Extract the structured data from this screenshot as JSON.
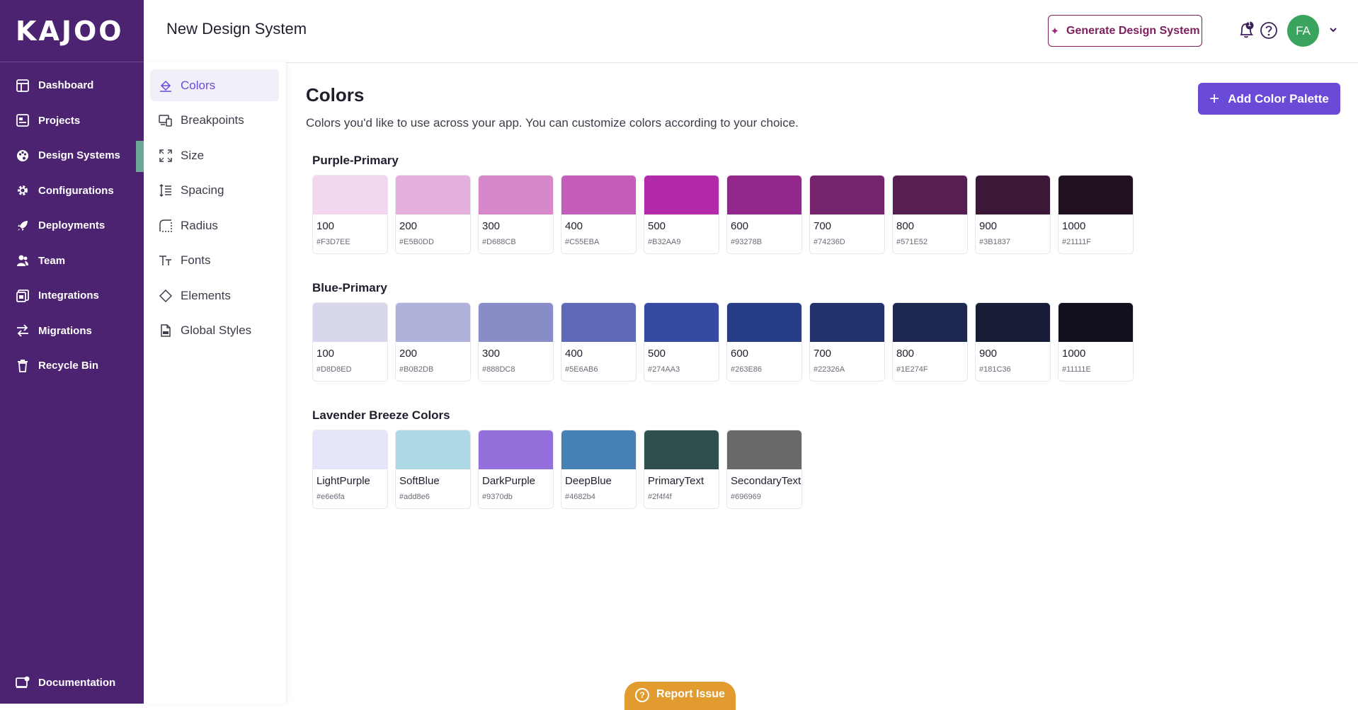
{
  "logo": "KAJOO",
  "sidebar": {
    "items": [
      {
        "label": "Dashboard",
        "icon": "dashboard-icon"
      },
      {
        "label": "Projects",
        "icon": "projects-icon"
      },
      {
        "label": "Design Systems",
        "icon": "palette-icon"
      },
      {
        "label": "Configurations",
        "icon": "gear-icon"
      },
      {
        "label": "Deployments",
        "icon": "rocket-icon"
      },
      {
        "label": "Team",
        "icon": "team-icon"
      },
      {
        "label": "Integrations",
        "icon": "integrations-icon"
      },
      {
        "label": "Migrations",
        "icon": "arrows-icon"
      },
      {
        "label": "Recycle Bin",
        "icon": "trash-icon"
      }
    ],
    "active": "Design Systems",
    "bottom": {
      "label": "Documentation",
      "icon": "docs-icon"
    }
  },
  "subnav": {
    "items": [
      {
        "label": "Colors",
        "icon": "paint-bucket-icon"
      },
      {
        "label": "Breakpoints",
        "icon": "devices-icon"
      },
      {
        "label": "Size",
        "icon": "expand-icon"
      },
      {
        "label": "Spacing",
        "icon": "line-spacing-icon"
      },
      {
        "label": "Radius",
        "icon": "radius-icon"
      },
      {
        "label": "Fonts",
        "icon": "text-icon"
      },
      {
        "label": "Elements",
        "icon": "diamond-icon"
      },
      {
        "label": "Global Styles",
        "icon": "css-file-icon"
      }
    ],
    "active": "Colors"
  },
  "topbar": {
    "title": "New Design System",
    "generate_label": "Generate Design System",
    "notification_count": "1",
    "avatar_initials": "FA"
  },
  "main": {
    "title": "Colors",
    "description": "Colors you'd like to use across your app. You can customize colors according to your choice.",
    "add_label": "Add Color Palette"
  },
  "palettes": [
    {
      "name": "Purple-Primary",
      "colors": [
        {
          "label": "100",
          "hex": "#F3D7EE",
          "color": "#F3D7EE"
        },
        {
          "label": "200",
          "hex": "#E5B0DD",
          "color": "#E5B0DD"
        },
        {
          "label": "300",
          "hex": "#D688CB",
          "color": "#D688CB"
        },
        {
          "label": "400",
          "hex": "#C55EBA",
          "color": "#C55EBA"
        },
        {
          "label": "500",
          "hex": "#B32AA9",
          "color": "#B32AA9"
        },
        {
          "label": "600",
          "hex": "#93278B",
          "color": "#93278B"
        },
        {
          "label": "700",
          "hex": "#74236D",
          "color": "#74236D"
        },
        {
          "label": "800",
          "hex": "#571E52",
          "color": "#571E52"
        },
        {
          "label": "900",
          "hex": "#3B1837",
          "color": "#3B1837"
        },
        {
          "label": "1000",
          "hex": "#21111F",
          "color": "#21111F"
        }
      ]
    },
    {
      "name": "Blue-Primary",
      "colors": [
        {
          "label": "100",
          "hex": "#D8D8ED",
          "color": "#D8D8ED"
        },
        {
          "label": "200",
          "hex": "#B0B2DB",
          "color": "#B0B2DB"
        },
        {
          "label": "300",
          "hex": "#888DC8",
          "color": "#888DC8"
        },
        {
          "label": "400",
          "hex": "#5E6AB6",
          "color": "#5E6AB6"
        },
        {
          "label": "500",
          "hex": "#274AA3",
          "color": "#374AA3"
        },
        {
          "label": "600",
          "hex": "#263E86",
          "color": "#263E86"
        },
        {
          "label": "700",
          "hex": "#22326A",
          "color": "#22326A"
        },
        {
          "label": "800",
          "hex": "#1E274F",
          "color": "#1E274F"
        },
        {
          "label": "900",
          "hex": "#181C36",
          "color": "#181C36"
        },
        {
          "label": "1000",
          "hex": "#11111E",
          "color": "#11111E"
        }
      ]
    },
    {
      "name": "Lavender Breeze Colors",
      "colors": [
        {
          "label": "LightPurple",
          "hex": "#e6e6fa",
          "color": "#e6e6fa"
        },
        {
          "label": "SoftBlue",
          "hex": "#add8e6",
          "color": "#add8e6"
        },
        {
          "label": "DarkPurple",
          "hex": "#9370db",
          "color": "#9370db"
        },
        {
          "label": "DeepBlue",
          "hex": "#4682b4",
          "color": "#4682b4"
        },
        {
          "label": "PrimaryText",
          "hex": "#2f4f4f",
          "color": "#2f4f4f"
        },
        {
          "label": "SecondaryText",
          "hex": "#696969",
          "color": "#696969"
        }
      ]
    }
  ],
  "report_label": "Report Issue",
  "colors": {
    "sidebar_bg": "#4b2370",
    "accent": "#6a4bd8",
    "generate_border": "#7b1f5e",
    "report_bg": "#e29b2e",
    "avatar_bg": "#3aa45e"
  }
}
